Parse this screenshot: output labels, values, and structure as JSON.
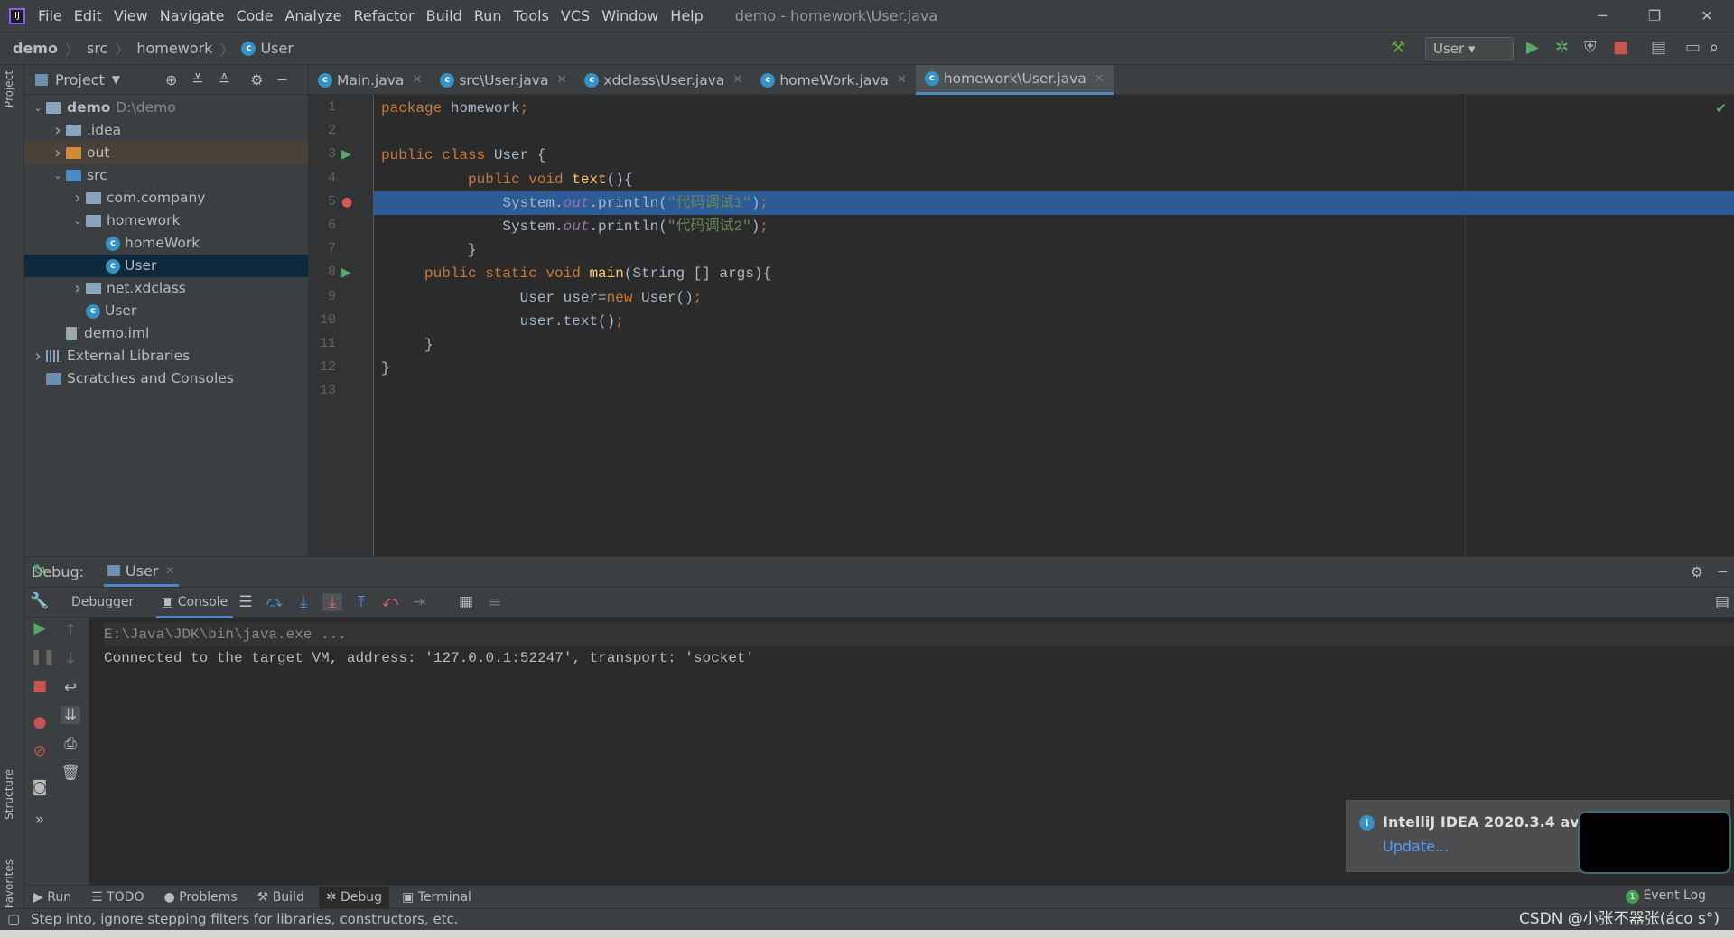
{
  "menubar": {
    "items": [
      "File",
      "Edit",
      "View",
      "Navigate",
      "Code",
      "Analyze",
      "Refactor",
      "Build",
      "Run",
      "Tools",
      "VCS",
      "Window",
      "Help"
    ],
    "title": "demo - homework\\User.java"
  },
  "navbar": {
    "crumbs": [
      "demo",
      "src",
      "homework",
      "User"
    ],
    "run_config": "User"
  },
  "left_strip": {
    "project": "Project",
    "structure": "Structure",
    "favorites": "Favorites"
  },
  "project": {
    "header": "Project",
    "tree": [
      {
        "label": "demo",
        "extra": "D:\\demo",
        "level": 0,
        "arrow": "down",
        "icon": "folder",
        "bold": true
      },
      {
        "label": ".idea",
        "level": 1,
        "arrow": "right",
        "icon": "folder"
      },
      {
        "label": "out",
        "level": 1,
        "arrow": "right",
        "icon": "folder-orange",
        "state": "excluded"
      },
      {
        "label": "src",
        "level": 1,
        "arrow": "down",
        "icon": "folder-blue"
      },
      {
        "label": "com.company",
        "level": 2,
        "arrow": "right",
        "icon": "package"
      },
      {
        "label": "homework",
        "level": 2,
        "arrow": "down",
        "icon": "package"
      },
      {
        "label": "homeWork",
        "level": 3,
        "icon": "class"
      },
      {
        "label": "User",
        "level": 3,
        "icon": "class",
        "selected": true
      },
      {
        "label": "net.xdclass",
        "level": 2,
        "arrow": "right",
        "icon": "package"
      },
      {
        "label": "User",
        "level": 2,
        "icon": "class"
      },
      {
        "label": "demo.iml",
        "level": 1,
        "icon": "file"
      },
      {
        "label": "External Libraries",
        "level": 0,
        "arrow": "right",
        "icon": "libraries"
      },
      {
        "label": "Scratches and Consoles",
        "level": 0,
        "icon": "scratches"
      }
    ]
  },
  "tabs": [
    {
      "label": "Main.java"
    },
    {
      "label": "src\\User.java"
    },
    {
      "label": "xdclass\\User.java"
    },
    {
      "label": "homeWork.java"
    },
    {
      "label": "homework\\User.java",
      "active": true
    }
  ],
  "editor": {
    "highlighted_line": 5,
    "lines": [
      [
        [
          "package",
          "kw"
        ],
        [
          " homework",
          ""
        ],
        [
          ";",
          "pc"
        ]
      ],
      [],
      [
        [
          "public class",
          "kw"
        ],
        [
          " User {",
          ""
        ]
      ],
      [
        [
          "          ",
          ""
        ],
        [
          "public void",
          "kw"
        ],
        [
          " ",
          ""
        ],
        [
          "text",
          "fn"
        ],
        [
          "(){",
          ""
        ]
      ],
      [
        [
          "              System.",
          ""
        ],
        [
          "out",
          "fl"
        ],
        [
          ".println(",
          ""
        ],
        [
          "\"代码调试1\"",
          "st"
        ],
        [
          ")",
          ""
        ],
        [
          ";",
          "pc"
        ]
      ],
      [
        [
          "              System.",
          ""
        ],
        [
          "out",
          "fl"
        ],
        [
          ".println(",
          ""
        ],
        [
          "\"代码调试2\"",
          "st"
        ],
        [
          ")",
          ""
        ],
        [
          ";",
          "pc"
        ]
      ],
      [
        [
          "          }",
          ""
        ]
      ],
      [
        [
          "     ",
          ""
        ],
        [
          "public static void",
          "kw"
        ],
        [
          " ",
          ""
        ],
        [
          "main",
          "fn"
        ],
        [
          "(String [] args){",
          ""
        ]
      ],
      [
        [
          "                User user=",
          ""
        ],
        [
          "new",
          "kw"
        ],
        [
          " User()",
          ""
        ],
        [
          ";",
          "pc"
        ]
      ],
      [
        [
          "                user.text()",
          ""
        ],
        [
          ";",
          "pc"
        ]
      ],
      [
        [
          "     }",
          ""
        ]
      ],
      [
        [
          "}",
          ""
        ]
      ],
      []
    ]
  },
  "debug": {
    "label": "Debug:",
    "session": "User",
    "tabs": [
      "Debugger",
      "Console"
    ],
    "console": [
      "E:\\Java\\JDK\\bin\\java.exe ...",
      "Connected to the target VM, address: '127.0.0.1:52247', transport: 'socket'"
    ]
  },
  "notification": {
    "title": "IntelliJ IDEA 2020.3.4 availabl",
    "link": "Update..."
  },
  "toolwindows": [
    "Run",
    "TODO",
    "Problems",
    "Build",
    "Debug",
    "Terminal"
  ],
  "event_log": {
    "label": "Event Log",
    "count": "1"
  },
  "status": {
    "text": "Step into, ignore stepping filters for libraries, constructors, etc."
  },
  "watermark": "CSDN @小张不器张(áco s°)",
  "colors": {
    "accent": "#4a88c7",
    "selection": "#2d5b96",
    "keyword": "#cc7832",
    "string": "#6a8759"
  }
}
